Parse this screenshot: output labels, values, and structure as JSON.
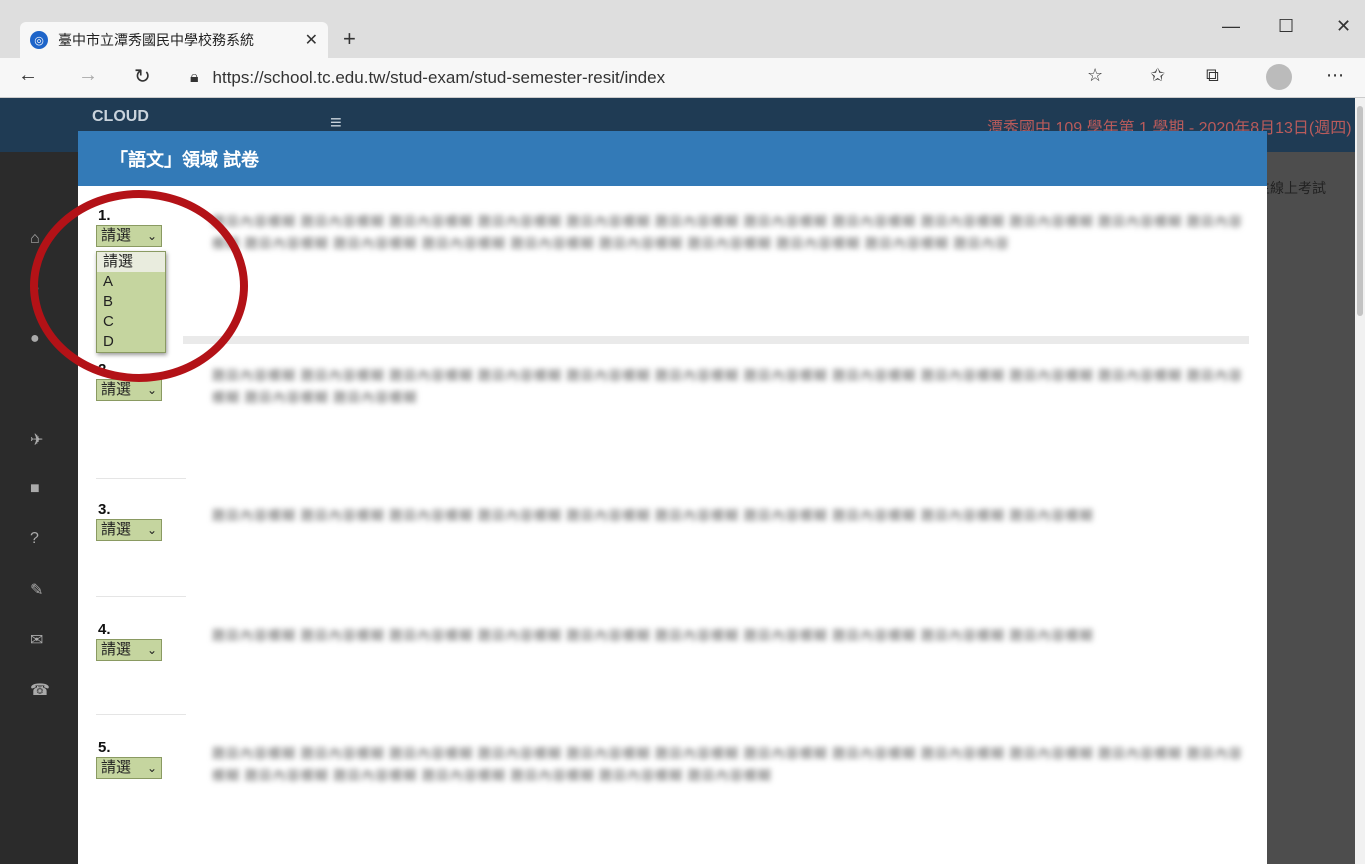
{
  "browser": {
    "tab_title": "臺中市立潭秀國民中學校務系統",
    "url": "https://school.tc.edu.tw/stud-exam/stud-semester-resit/index",
    "new_tab": "+",
    "minimize": "—",
    "maximize": "☐",
    "close": "✕"
  },
  "page_header": {
    "logo": "CLOUD",
    "info": "潭秀國中 109 學年第 1 學期 - 2020年8月13日(週四)",
    "right_label": "生線上考試"
  },
  "modal": {
    "title": "「語文」領域 試卷",
    "select_placeholder": "請選",
    "questions": [
      {
        "num": "1.",
        "text": "題目內容模糊 題目內容模糊 題目內容模糊 題目內容模糊 題目內容模糊 題目內容模糊 題目內容模糊 題目內容模糊 題目內容模糊 題目內容模糊 題目內容模糊 題目內容模糊 題目內容模糊 題目內容模糊 題目內容模糊 題目內容模糊 題目內容模糊 題目內容模糊 題目內容模糊 題目內容模糊 題目內容"
      },
      {
        "num": "2.",
        "text": "題目內容模糊 題目內容模糊 題目內容模糊 題目內容模糊 題目內容模糊 題目內容模糊 題目內容模糊 題目內容模糊 題目內容模糊 題目內容模糊 題目內容模糊 題目內容模糊 題目內容模糊 題目內容模糊"
      },
      {
        "num": "3.",
        "text": "題目內容模糊 題目內容模糊 題目內容模糊 題目內容模糊 題目內容模糊 題目內容模糊 題目內容模糊 題目內容模糊 題目內容模糊 題目內容模糊"
      },
      {
        "num": "4.",
        "text": "題目內容模糊 題目內容模糊 題目內容模糊 題目內容模糊 題目內容模糊 題目內容模糊 題目內容模糊 題目內容模糊 題目內容模糊 題目內容模糊"
      },
      {
        "num": "5.",
        "text": "題目內容模糊 題目內容模糊 題目內容模糊 題目內容模糊 題目內容模糊 題目內容模糊 題目內容模糊 題目內容模糊 題目內容模糊 題目內容模糊 題目內容模糊 題目內容模糊 題目內容模糊 題目內容模糊 題目內容模糊 題目內容模糊 題目內容模糊 題目內容模糊"
      }
    ]
  },
  "dropdown_options": [
    "請選",
    "A",
    "B",
    "C",
    "D"
  ]
}
